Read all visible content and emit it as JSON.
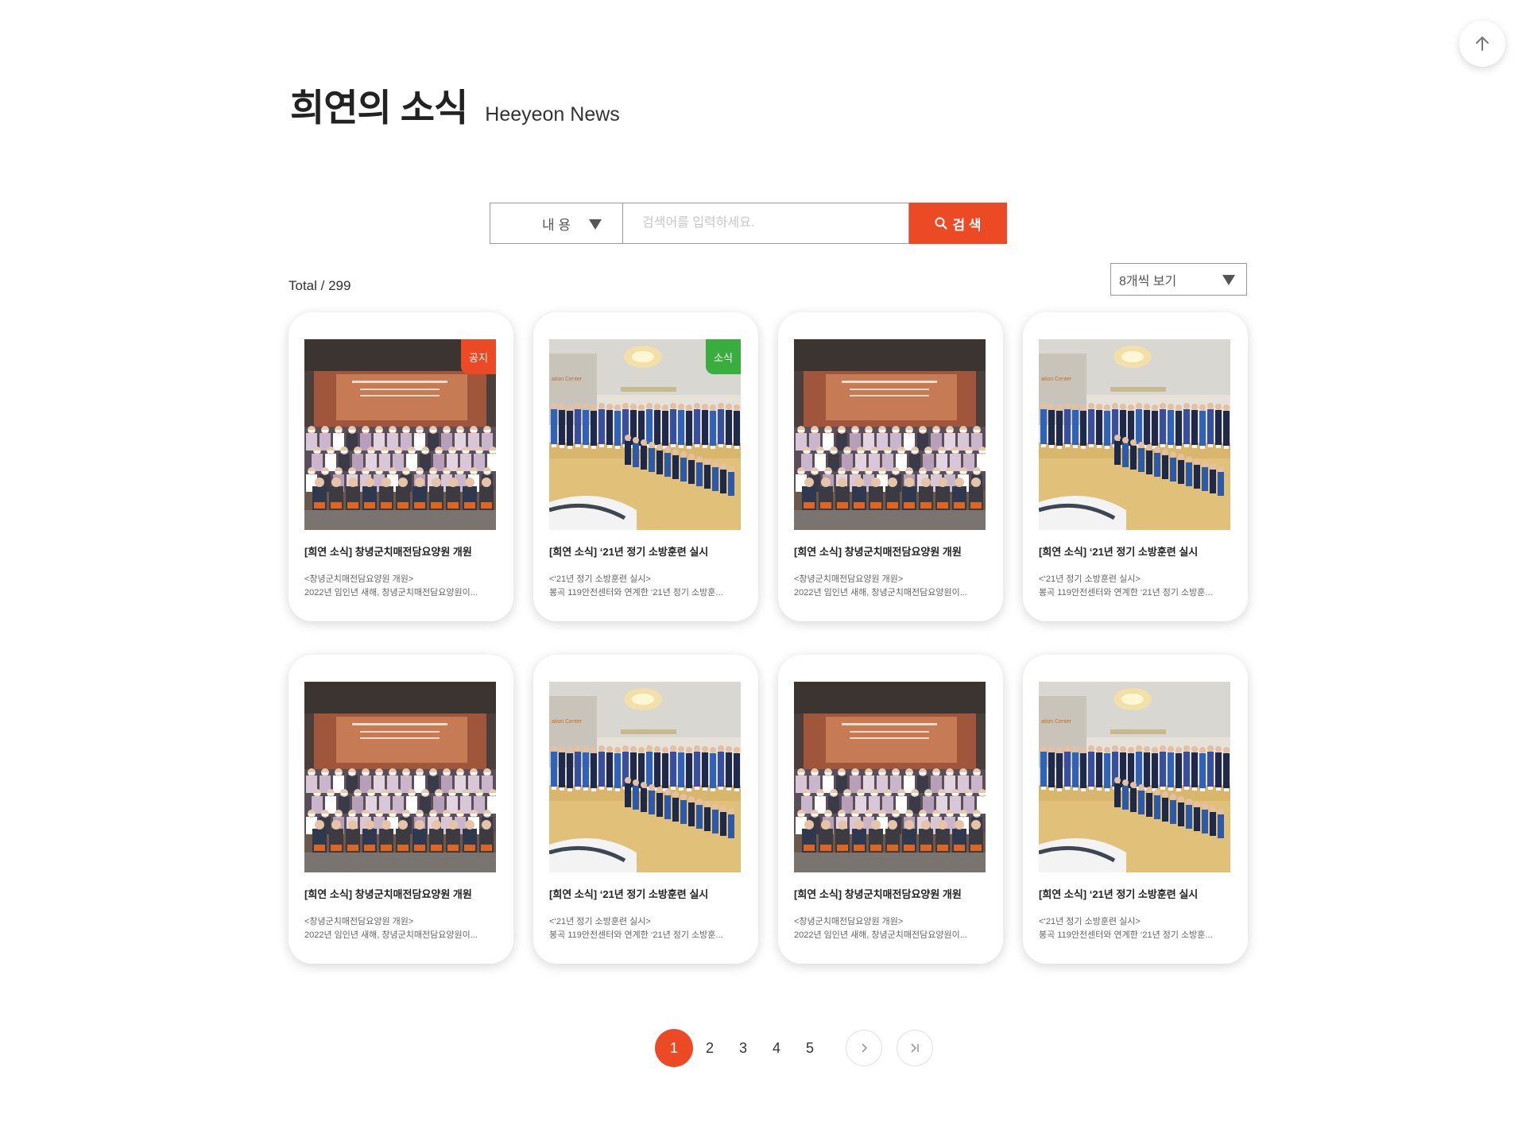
{
  "header": {
    "title": "희연의 소식",
    "subtitle": "Heeyeon News"
  },
  "search": {
    "field_label": "내 용",
    "placeholder": "검색어를 입력하세요.",
    "button_label": "검 색"
  },
  "list": {
    "total_label": "Total / 299",
    "per_page_label": "8개씩 보기"
  },
  "colors": {
    "accent": "#ec4a24",
    "notice_badge": "#ec4a24",
    "news_badge": "#3aad3f"
  },
  "cards": [
    {
      "title": "[희연 소식] 창녕군치매전담요양원 개원",
      "excerpt_line1": "<창녕군치매전담요양원 개원>",
      "excerpt_line2": "2022년 임인년 새해, 창녕군치매전담요양원이...",
      "badge": "공지"
    },
    {
      "title": "[희연 소식] ‘21년 정기 소방훈련 실시",
      "excerpt_line1": "<‘21년 정기 소방훈련 실시>",
      "excerpt_line2": "봉곡 119안전센터와 연계한 ‘21년 정기 소방훈...",
      "badge": "소식"
    },
    {
      "title": "[희연 소식] 창녕군치매전담요양원 개원",
      "excerpt_line1": "<창녕군치매전담요양원 개원>",
      "excerpt_line2": "2022년 임인년 새해, 창녕군치매전담요양원이...",
      "badge": ""
    },
    {
      "title": "[희연 소식] ‘21년 정기 소방훈련 실시",
      "excerpt_line1": "<‘21년 정기 소방훈련 실시>",
      "excerpt_line2": "봉곡 119안전센터와 연계한 ‘21년 정기 소방훈...",
      "badge": ""
    },
    {
      "title": "[희연 소식] 창녕군치매전담요양원 개원",
      "excerpt_line1": "<창녕군치매전담요양원 개원>",
      "excerpt_line2": "2022년 임인년 새해, 창녕군치매전담요양원이...",
      "badge": ""
    },
    {
      "title": "[희연 소식] ‘21년 정기 소방훈련 실시",
      "excerpt_line1": "<‘21년 정기 소방훈련 실시>",
      "excerpt_line2": "봉곡 119안전센터와 연계한 ‘21년 정기 소방훈...",
      "badge": ""
    },
    {
      "title": "[희연 소식] 창녕군치매전담요양원 개원",
      "excerpt_line1": "<창녕군치매전담요양원 개원>",
      "excerpt_line2": "2022년 임인년 새해, 창녕군치매전담요양원이...",
      "badge": ""
    },
    {
      "title": "[희연 소식] ‘21년 정기 소방훈련 실시",
      "excerpt_line1": "<‘21년 정기 소방훈련 실시>",
      "excerpt_line2": "봉곡 119안전센터와 연계한 ‘21년 정기 소방훈...",
      "badge": ""
    }
  ],
  "pagination": {
    "pages": [
      "1",
      "2",
      "3",
      "4",
      "5"
    ],
    "current": "1"
  },
  "icons": {
    "scroll_top": "arrow-up-icon",
    "search": "search-icon",
    "dropdown": "caret-down-icon",
    "next": "chevron-right-icon",
    "last": "last-page-icon"
  }
}
